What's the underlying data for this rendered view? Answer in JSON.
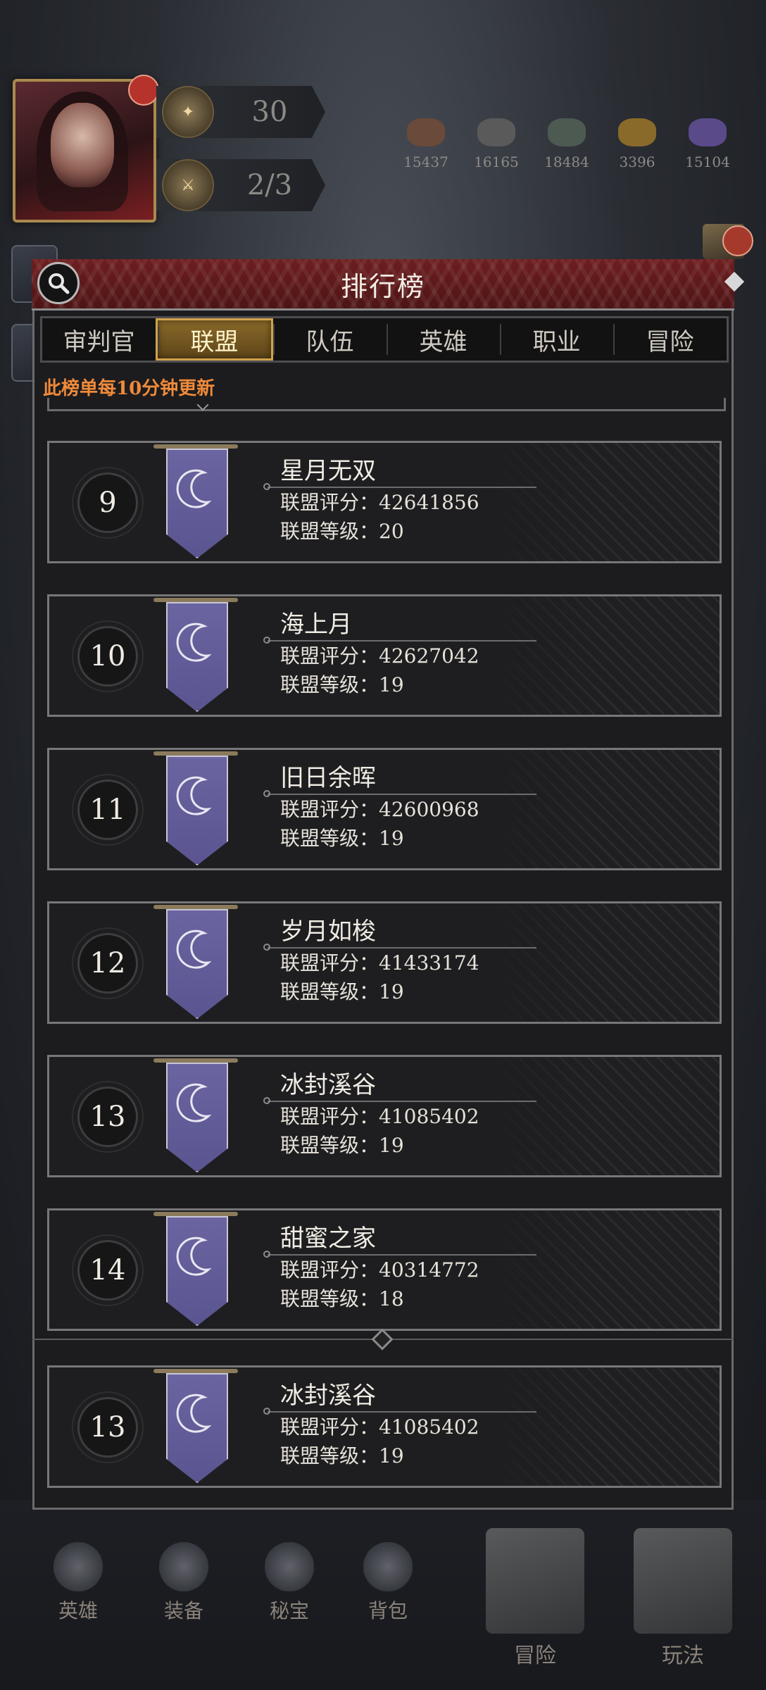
{
  "hud": {
    "stat_level": "30",
    "stat_stamina": "2/3",
    "resources": [
      {
        "name": "ore-icon",
        "amount": "15437",
        "color": "#6a4a3a"
      },
      {
        "name": "stone-icon",
        "amount": "16165",
        "color": "#5a5a5a"
      },
      {
        "name": "crystal-icon",
        "amount": "18484",
        "color": "#4d5a52"
      },
      {
        "name": "gold-icon",
        "amount": "3396",
        "color": "#8a6a2a"
      },
      {
        "name": "gem-icon",
        "amount": "15104",
        "color": "#5a4a8a"
      }
    ]
  },
  "panel": {
    "title": "排行榜",
    "tabs": [
      "审判官",
      "联盟",
      "队伍",
      "英雄",
      "职业",
      "冒险"
    ],
    "active_tab": "联盟",
    "notice": "此榜单每10分钟更新",
    "score_label": "联盟评分：",
    "level_label": "联盟等级："
  },
  "rankings": [
    {
      "rank": "9",
      "name": "星月无双",
      "score": "42641856",
      "level": "20"
    },
    {
      "rank": "10",
      "name": "海上月",
      "score": "42627042",
      "level": "19"
    },
    {
      "rank": "11",
      "name": "旧日余晖",
      "score": "42600968",
      "level": "19"
    },
    {
      "rank": "12",
      "name": "岁月如梭",
      "score": "41433174",
      "level": "19"
    },
    {
      "rank": "13",
      "name": "冰封溪谷",
      "score": "41085402",
      "level": "19"
    },
    {
      "rank": "14",
      "name": "甜蜜之家",
      "score": "40314772",
      "level": "18"
    }
  ],
  "my_alliance": {
    "rank": "13",
    "name": "冰封溪谷",
    "score": "41085402",
    "level": "19"
  },
  "bottom_nav": [
    "英雄",
    "装备",
    "秘宝",
    "背包",
    "冒险",
    "玩法"
  ]
}
